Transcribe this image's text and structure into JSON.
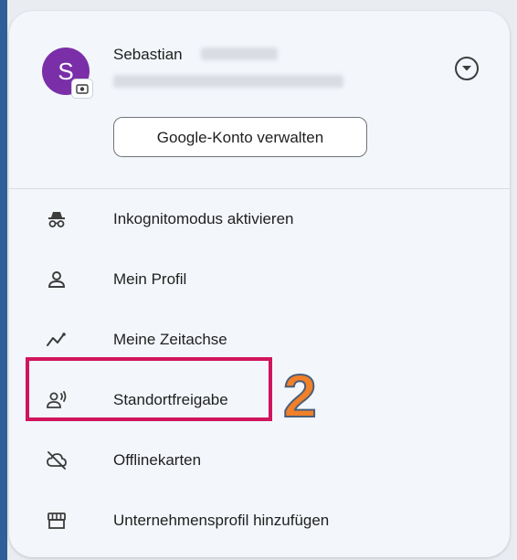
{
  "account": {
    "initial": "S",
    "first_name": "Sebastian",
    "manage_button": "Google-Konto verwalten"
  },
  "menu": {
    "items": [
      {
        "label": "Inkognitomodus aktivieren",
        "icon": "incognito-icon"
      },
      {
        "label": "Mein Profil",
        "icon": "person-icon"
      },
      {
        "label": "Meine Zeitachse",
        "icon": "timeline-icon"
      },
      {
        "label": "Standortfreigabe",
        "icon": "location-sharing-icon"
      },
      {
        "label": "Offlinekarten",
        "icon": "offline-maps-icon"
      },
      {
        "label": "Unternehmensprofil hinzufügen",
        "icon": "storefront-icon"
      }
    ]
  },
  "annotation": {
    "step": "2",
    "highlight_color": "#d0155d",
    "step_color": "#f28028"
  },
  "colors": {
    "avatar": "#7a2fa8",
    "panel": "#f3f6fb"
  }
}
